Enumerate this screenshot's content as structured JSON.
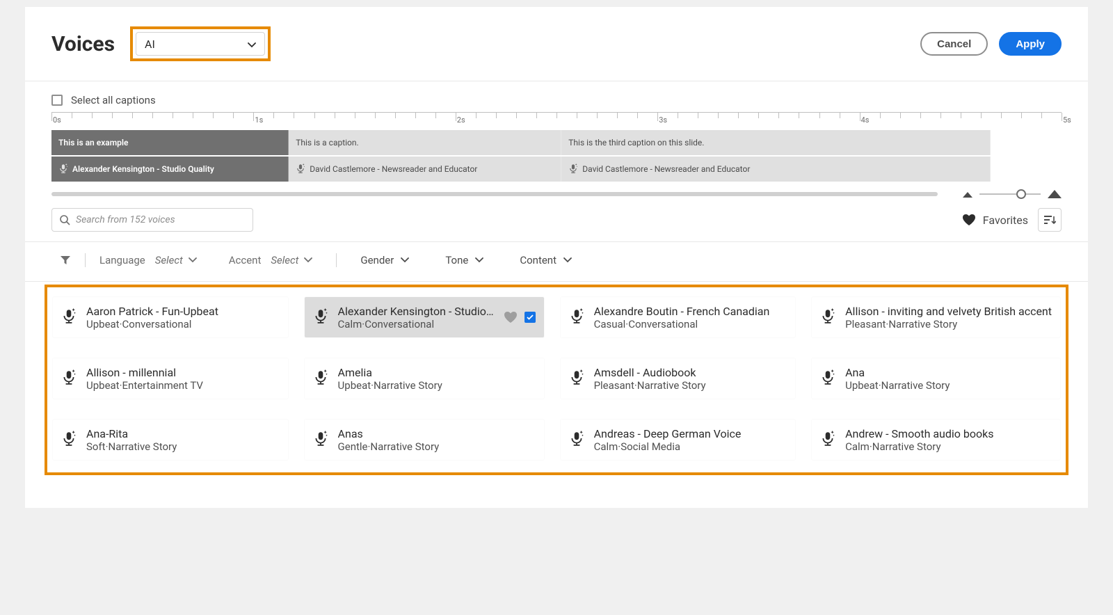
{
  "header": {
    "title": "Voices",
    "voice_type": "AI",
    "cancel": "Cancel",
    "apply": "Apply"
  },
  "selectall_label": "Select all captions",
  "ruler_marks": [
    "0s",
    "1s",
    "2s",
    "3s",
    "4s",
    "5s"
  ],
  "captions": [
    {
      "text": "This is an example",
      "selected": true
    },
    {
      "text": "This is a caption.",
      "selected": false
    },
    {
      "text": "This is the third caption on this slide.",
      "selected": false
    }
  ],
  "caption_voices": [
    {
      "text": "Alexander Kensington - Studio Quality",
      "selected": true
    },
    {
      "text": "David Castlemore - Newsreader and Educator",
      "selected": false
    },
    {
      "text": "David Castlemore - Newsreader and Educator",
      "selected": false
    }
  ],
  "search": {
    "placeholder": "Search from 152 voices"
  },
  "favorites_label": "Favorites",
  "filters": {
    "language_label": "Language",
    "language_value": "Select",
    "accent_label": "Accent",
    "accent_value": "Select",
    "gender": "Gender",
    "tone": "Tone",
    "content": "Content"
  },
  "voices": [
    {
      "name": "Aaron Patrick - Fun-Upbeat",
      "tags": "Upbeat·Conversational",
      "selected": false
    },
    {
      "name": "Alexander Kensington - Studio…",
      "tags": "Calm·Conversational",
      "selected": true
    },
    {
      "name": "Alexandre Boutin - French Canadian",
      "tags": "Casual·Conversational",
      "selected": false
    },
    {
      "name": "Allison - inviting and velvety British accent",
      "tags": "Pleasant·Narrative Story",
      "selected": false
    },
    {
      "name": "Allison - millennial",
      "tags": "Upbeat·Entertainment TV",
      "selected": false
    },
    {
      "name": "Amelia",
      "tags": "Upbeat·Narrative Story",
      "selected": false
    },
    {
      "name": "Amsdell - Audiobook",
      "tags": "Pleasant·Narrative Story",
      "selected": false
    },
    {
      "name": "Ana",
      "tags": "Upbeat·Narrative Story",
      "selected": false
    },
    {
      "name": "Ana-Rita",
      "tags": "Soft·Narrative Story",
      "selected": false
    },
    {
      "name": "Anas",
      "tags": "Gentle·Narrative Story",
      "selected": false
    },
    {
      "name": "Andreas - Deep German Voice",
      "tags": "Calm·Social Media",
      "selected": false
    },
    {
      "name": "Andrew - Smooth audio books",
      "tags": "Calm·Narrative Story",
      "selected": false
    }
  ]
}
